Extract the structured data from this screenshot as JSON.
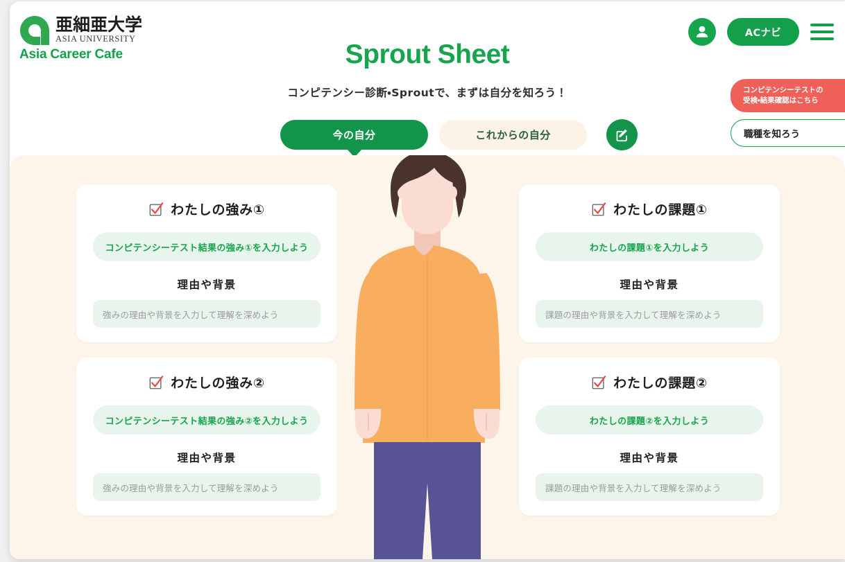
{
  "brand": {
    "logo_icon": "asia-university-logo-icon",
    "name_jp": "亜細亜大学",
    "name_en": "ASIA UNIVERSITY",
    "tagline": "Asia Career Cafe"
  },
  "header": {
    "title": "Sprout Sheet",
    "subtitle": "コンピテンシー診断・Sproutで、まずは自分を知ろう！",
    "avatar_icon": "user-avatar-icon",
    "acnavi_label": "ACナビ",
    "menu_icon": "hamburger-menu-icon"
  },
  "tabs": [
    {
      "label": "今の自分",
      "active": true
    },
    {
      "label": "これからの自分",
      "active": false
    }
  ],
  "edit_button": {
    "icon": "edit-pencil-square-icon"
  },
  "floating_buttons": {
    "competency_test": "コンピテンシーテストの\n受検・結果確認はこちら",
    "competency_test_line1": "コンピテンシーテストの",
    "competency_test_line2": "受検・結果確認はこちら",
    "job_types": "職種を知ろう"
  },
  "cards": [
    {
      "checkbox_icon": "checked-checkbox-icon",
      "title": "わたしの強み①",
      "input_placeholder": "コンピテンシーテスト結果の強み①を入力しよう",
      "sub_heading": "理由や背景",
      "textarea_placeholder": "強みの理由や背景を入力して理解を深めよう"
    },
    {
      "checkbox_icon": "checked-checkbox-icon",
      "title": "わたしの課題①",
      "input_placeholder": "わたしの課題①を入力しよう",
      "sub_heading": "理由や背景",
      "textarea_placeholder": "課題の理由や背景を入力して理解を深めよう"
    },
    {
      "checkbox_icon": "checked-checkbox-icon",
      "title": "わたしの強み②",
      "input_placeholder": "コンピテンシーテスト結果の強み②を入力しよう",
      "sub_heading": "理由や背景",
      "textarea_placeholder": "強みの理由や背景を入力して理解を深めよう"
    },
    {
      "checkbox_icon": "checked-checkbox-icon",
      "title": "わたしの課題②",
      "input_placeholder": "わたしの課題②を入力しよう",
      "sub_heading": "理由や背景",
      "textarea_placeholder": "課題の理由や背景を入力して理解を深めよう"
    }
  ],
  "illustration": {
    "name": "standing-person-illustration",
    "hair_color": "#4a332c",
    "skin_color": "#fadcd2",
    "shirt_color": "#f9ae5f",
    "pants_color": "#585394"
  },
  "colors": {
    "brand_green": "#14a04b",
    "accent_red": "#ef6058",
    "body_cream": "#fdf5ea",
    "pill_green_bg": "#e8f5ec"
  }
}
